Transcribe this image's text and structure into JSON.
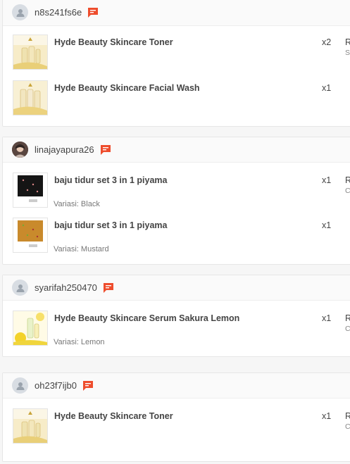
{
  "colors": {
    "chat_accent": "#ee4d2d",
    "header_bg": "#fafafa",
    "card_bg": "#ffffff",
    "page_bg": "#f6f6f6"
  },
  "orders": [
    {
      "username": "n8s241fs6e",
      "avatar": "default-user-icon",
      "items": [
        {
          "name": "Hyde Beauty Skincare Toner",
          "variant": "",
          "qty": "x2",
          "price_head": "R",
          "price_sub": "S"
        },
        {
          "name": "Hyde Beauty Skincare Facial Wash",
          "variant": "",
          "qty": "x1",
          "price_head": "",
          "price_sub": ""
        }
      ]
    },
    {
      "username": "linajayapura26",
      "avatar": "profile-photo",
      "items": [
        {
          "name": "baju tidur set 3 in 1 piyama",
          "variant": "Variasi: Black",
          "qty": "x1",
          "price_head": "R",
          "price_sub": "C"
        },
        {
          "name": "baju tidur set 3 in 1 piyama",
          "variant": "Variasi: Mustard",
          "qty": "x1",
          "price_head": "",
          "price_sub": ""
        }
      ]
    },
    {
      "username": "syarifah250470",
      "avatar": "default-user-icon",
      "items": [
        {
          "name": "Hyde Beauty Skincare Serum Sakura Lemon",
          "variant": "Variasi: Lemon",
          "qty": "x1",
          "price_head": "R",
          "price_sub": "C"
        }
      ]
    },
    {
      "username": "oh23f7ijb0",
      "avatar": "default-user-icon",
      "items": [
        {
          "name": "Hyde Beauty Skincare Toner",
          "variant": "",
          "qty": "x1",
          "price_head": "R",
          "price_sub": "C"
        }
      ]
    }
  ]
}
